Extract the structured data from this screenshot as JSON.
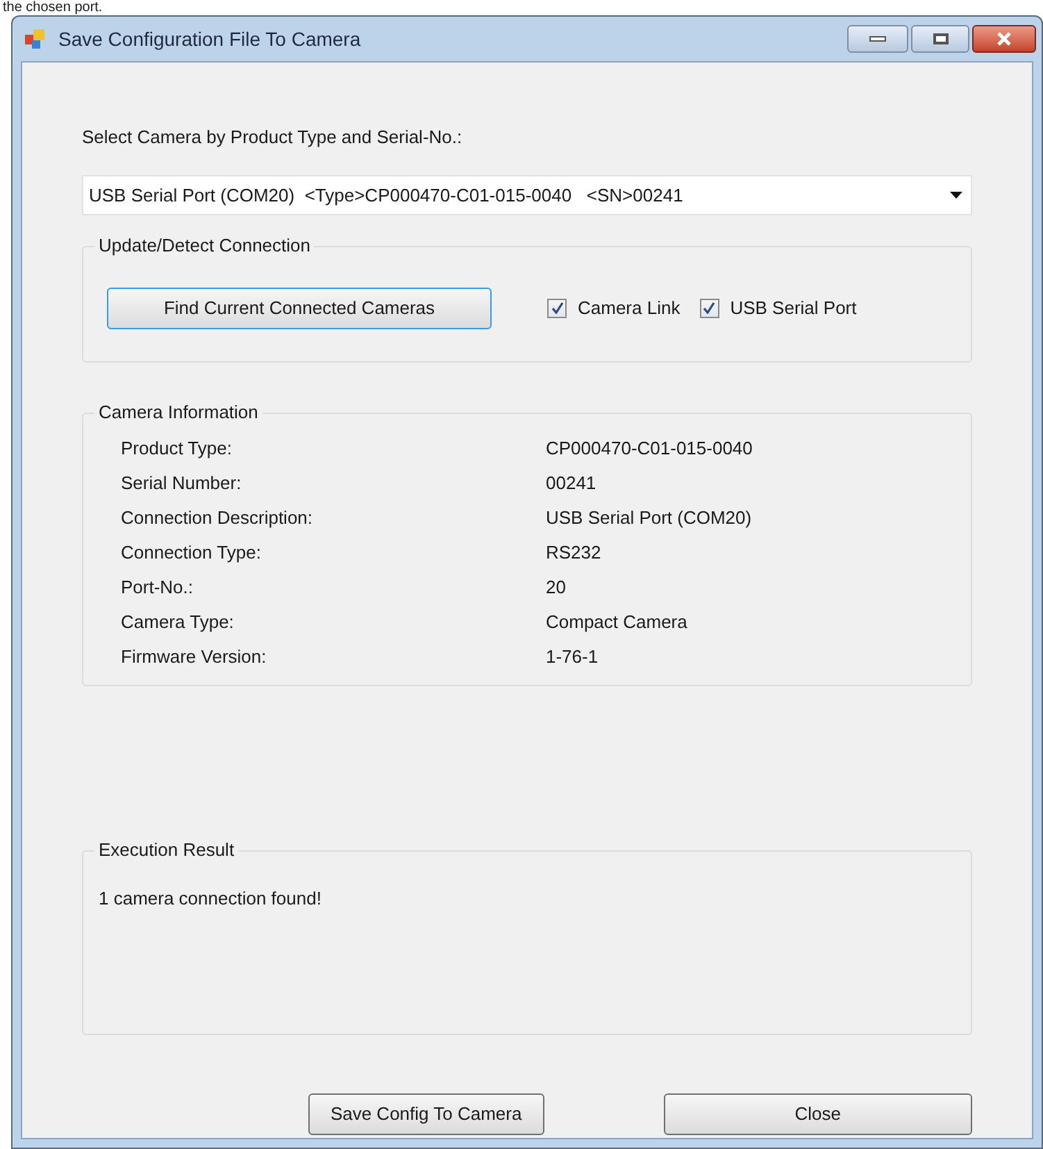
{
  "caption": "the chosen port.",
  "window": {
    "title": "Save Configuration File To Camera"
  },
  "camera_select": {
    "label": "Select Camera by Product Type and Serial-No.:",
    "value": "USB Serial Port (COM20)  <Type>CP000470-C01-015-0040   <SN>00241"
  },
  "update_group": {
    "title": "Update/Detect Connection",
    "button": "Find Current Connected Cameras",
    "checkboxes": [
      {
        "label": "Camera Link",
        "checked": true
      },
      {
        "label": "USB Serial Port",
        "checked": true
      }
    ]
  },
  "camera_info": {
    "title": "Camera Information",
    "rows": [
      {
        "label": "Product Type:",
        "value": "CP000470-C01-015-0040"
      },
      {
        "label": "Serial Number:",
        "value": "00241"
      },
      {
        "label": "Connection Description:",
        "value": "USB Serial Port (COM20)"
      },
      {
        "label": "Connection Type:",
        "value": "RS232"
      },
      {
        "label": "Port-No.:",
        "value": "20"
      },
      {
        "label": "Camera Type:",
        "value": "Compact Camera"
      },
      {
        "label": "Firmware Version:",
        "value": "1-76-1"
      }
    ]
  },
  "execution_result": {
    "title": "Execution Result",
    "text": "1 camera connection found!"
  },
  "buttons": [
    "Save Config To Camera",
    "Close"
  ]
}
